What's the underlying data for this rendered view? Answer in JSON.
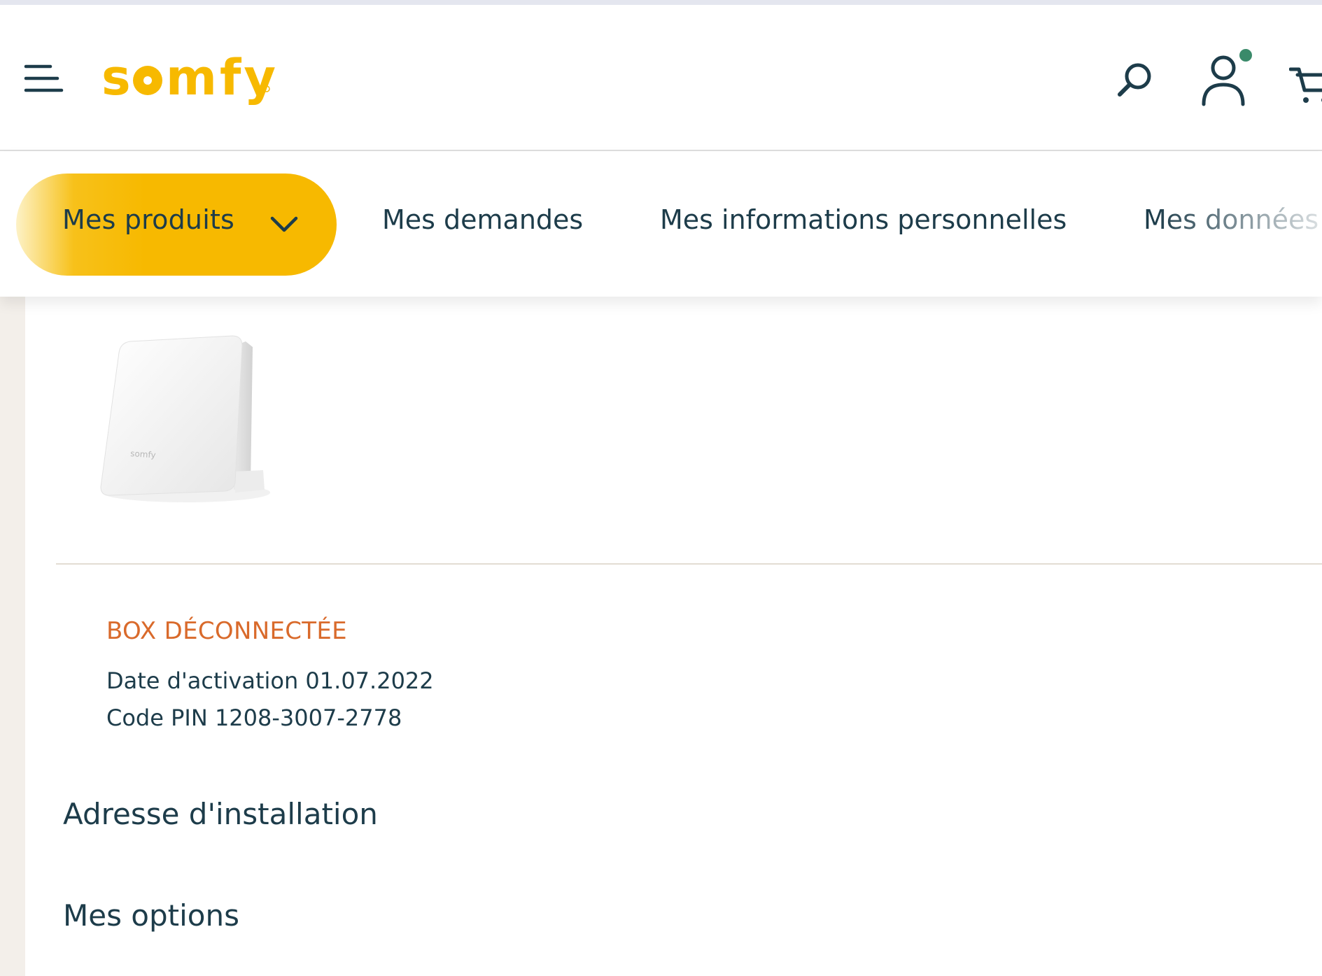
{
  "brand": {
    "logo_text": "somfy",
    "accent_color": "#f7b900",
    "text_color": "#1d3c4a",
    "status_color": "#d96a2b",
    "notification_dot_color": "#3a8a6a"
  },
  "header": {
    "icons": [
      "menu-icon",
      "search-icon",
      "account-icon",
      "cart-icon"
    ]
  },
  "nav": {
    "active": "Mes produits",
    "items": [
      "Mes demandes",
      "Mes informations personnelles",
      "Mes données"
    ]
  },
  "product": {
    "status": "BOX DÉCONNECTÉE",
    "activation_label": "Date d'activation",
    "activation_date": "01.07.2022",
    "pin_label": "Code PIN",
    "pin": "1208-3007-2778"
  },
  "sections": {
    "address": "Adresse d'installation",
    "options": "Mes options"
  }
}
